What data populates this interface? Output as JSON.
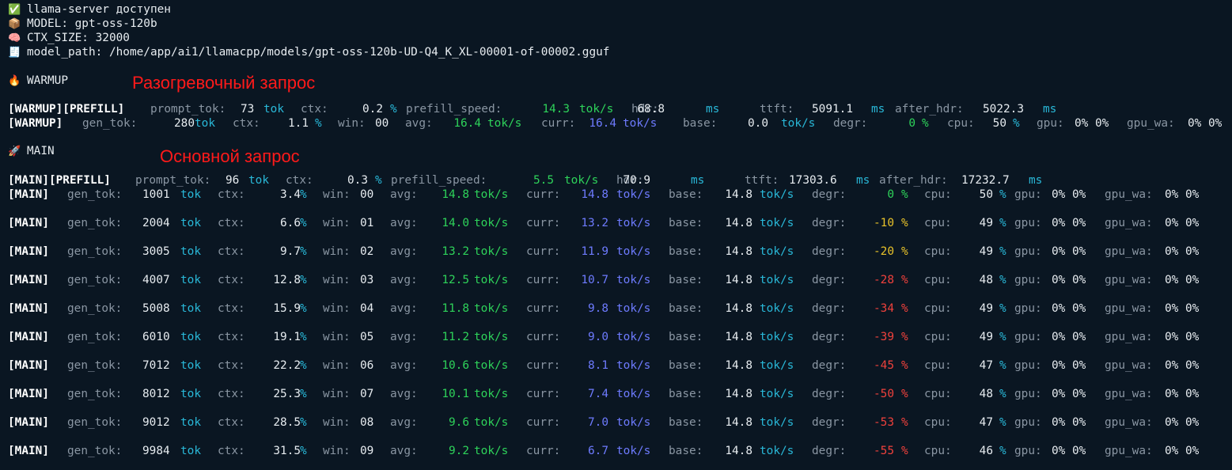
{
  "header": {
    "server_status": "llama-server доступен",
    "model": "MODEL: gpt-oss-120b",
    "ctx_size": "CTX_SIZE: 32000",
    "model_path": "model_path: /home/app/ai1/llamacpp/models/gpt-oss-120b-UD-Q4_K_XL-00001-of-00002.gguf"
  },
  "icons": {
    "status": "check-icon",
    "model": "package-icon",
    "ctx": "brain-icon",
    "path": "receipt-icon",
    "warmup": "fire-icon",
    "main": "rocket-icon"
  },
  "warmup": {
    "title": "WARMUP",
    "annotation": "Разогревочный запрос",
    "prefill": {
      "tag": "[WARMUP][PREFILL]",
      "prompt_tok": "73",
      "ctx": "0.2",
      "prefill_speed": "14.3",
      "hdr": "68.8",
      "ttft": "5091.1",
      "after_hdr": "5022.3"
    },
    "gen": {
      "tag": "[WARMUP]",
      "gen_tok": "280",
      "ctx": "1.1",
      "win": "00",
      "avg": "16.4",
      "curr": "16.4",
      "base": "0.0",
      "degr": "0",
      "cpu": "50",
      "gpu": "0% 0%",
      "gpu_wa": "0% 0%"
    }
  },
  "main": {
    "title": "MAIN",
    "annotation": "Основной запрос",
    "prefill": {
      "tag": "[MAIN][PREFILL]",
      "prompt_tok": "96",
      "ctx": "0.3",
      "prefill_speed": "5.5",
      "hdr": "70.9",
      "ttft": "17303.6",
      "after_hdr": "17232.7"
    },
    "rows": [
      {
        "tag": "[MAIN]",
        "gen_tok": "1001",
        "ctx": "3.4",
        "win": "00",
        "avg": "14.8",
        "curr": "14.8",
        "base": "14.8",
        "degr": "0",
        "degr_level": "ok",
        "cpu": "50",
        "gpu": "0% 0%",
        "gpu_wa": "0% 0%"
      },
      {
        "tag": "[MAIN]",
        "gen_tok": "2004",
        "ctx": "6.6",
        "win": "01",
        "avg": "14.0",
        "curr": "13.2",
        "base": "14.8",
        "degr": "-10",
        "degr_level": "warn",
        "cpu": "49",
        "gpu": "0% 0%",
        "gpu_wa": "0% 0%"
      },
      {
        "tag": "[MAIN]",
        "gen_tok": "3005",
        "ctx": "9.7",
        "win": "02",
        "avg": "13.2",
        "curr": "11.9",
        "base": "14.8",
        "degr": "-20",
        "degr_level": "warn",
        "cpu": "49",
        "gpu": "0% 0%",
        "gpu_wa": "0% 0%"
      },
      {
        "tag": "[MAIN]",
        "gen_tok": "4007",
        "ctx": "12.8",
        "win": "03",
        "avg": "12.5",
        "curr": "10.7",
        "base": "14.8",
        "degr": "-28",
        "degr_level": "bad",
        "cpu": "48",
        "gpu": "0% 0%",
        "gpu_wa": "0% 0%"
      },
      {
        "tag": "[MAIN]",
        "gen_tok": "5008",
        "ctx": "15.9",
        "win": "04",
        "avg": "11.8",
        "curr": "9.8",
        "base": "14.8",
        "degr": "-34",
        "degr_level": "bad",
        "cpu": "49",
        "gpu": "0% 0%",
        "gpu_wa": "0% 0%"
      },
      {
        "tag": "[MAIN]",
        "gen_tok": "6010",
        "ctx": "19.1",
        "win": "05",
        "avg": "11.2",
        "curr": "9.0",
        "base": "14.8",
        "degr": "-39",
        "degr_level": "bad",
        "cpu": "49",
        "gpu": "0% 0%",
        "gpu_wa": "0% 0%"
      },
      {
        "tag": "[MAIN]",
        "gen_tok": "7012",
        "ctx": "22.2",
        "win": "06",
        "avg": "10.6",
        "curr": "8.1",
        "base": "14.8",
        "degr": "-45",
        "degr_level": "bad",
        "cpu": "47",
        "gpu": "0% 0%",
        "gpu_wa": "0% 0%"
      },
      {
        "tag": "[MAIN]",
        "gen_tok": "8012",
        "ctx": "25.3",
        "win": "07",
        "avg": "10.1",
        "curr": "7.4",
        "base": "14.8",
        "degr": "-50",
        "degr_level": "bad",
        "cpu": "48",
        "gpu": "0% 0%",
        "gpu_wa": "0% 0%"
      },
      {
        "tag": "[MAIN]",
        "gen_tok": "9012",
        "ctx": "28.5",
        "win": "08",
        "avg": "9.6",
        "curr": "7.0",
        "base": "14.8",
        "degr": "-53",
        "degr_level": "bad",
        "cpu": "47",
        "gpu": "0% 0%",
        "gpu_wa": "0% 0%"
      },
      {
        "tag": "[MAIN]",
        "gen_tok": "9984",
        "ctx": "31.5",
        "win": "09",
        "avg": "9.2",
        "curr": "6.7",
        "base": "14.8",
        "degr": "-55",
        "degr_level": "bad",
        "cpu": "46",
        "gpu": "0% 0%",
        "gpu_wa": "0% 0%"
      }
    ]
  },
  "labels": {
    "prompt_tok": "prompt_tok:",
    "gen_tok": "gen_tok:",
    "ctx": "ctx:",
    "prefill_speed": "prefill_speed:",
    "hdr": "hdr:",
    "ttft": "ttft:",
    "after_hdr": "after_hdr:",
    "win": "win:",
    "avg": "avg:",
    "curr": "curr:",
    "base": "base:",
    "degr": "degr:",
    "cpu": "cpu:",
    "gpu": "gpu:",
    "gpu_wa": "gpu_wa:",
    "tok": "tok",
    "pct": "%",
    "toks": "tok/s",
    "ms": "ms"
  },
  "colors": {
    "background": "#0a1622",
    "unit": "#29b8d8",
    "speed_avg": "#2ed35a",
    "speed_curr": "#6e7bff",
    "degr_warn": "#e8c22a",
    "degr_bad": "#f0413c",
    "annotation": "#ff1a1a"
  }
}
